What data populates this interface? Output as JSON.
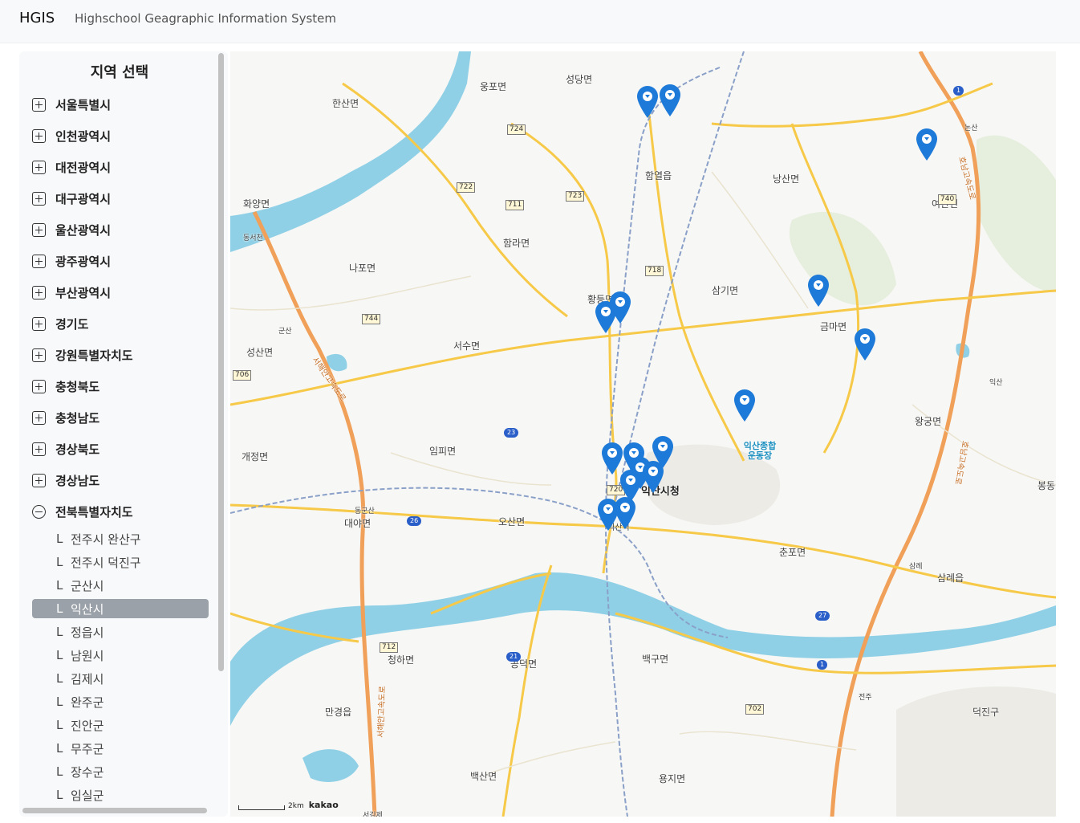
{
  "header": {
    "brand": "HGIS",
    "subtitle": "Highschool Geagraphic Information System"
  },
  "sidebar": {
    "title": "지역 선택",
    "regions": [
      "서울특별시",
      "인천광역시",
      "대전광역시",
      "대구광역시",
      "울산광역시",
      "광주광역시",
      "부산광역시",
      "경기도",
      "강원특별자치도",
      "충청북도",
      "충청남도",
      "경상북도",
      "경상남도",
      "전북특별자치도"
    ],
    "sub_marker": "L",
    "sub_items": [
      "전주시 완산구",
      "전주시 덕진구",
      "군산시",
      "익산시",
      "정읍시",
      "남원시",
      "김제시",
      "완주군",
      "진안군",
      "무주군",
      "장수군",
      "임실군"
    ],
    "selected_sub": "익산시"
  },
  "map": {
    "place_labels": [
      "웅포면",
      "성당면",
      "한산면",
      "함열읍",
      "낭산면",
      "여산면",
      "화양면",
      "동서천",
      "나포면",
      "함라면",
      "삼기면",
      "황등면",
      "금마면",
      "군산",
      "성산면",
      "서수면",
      "왕궁면",
      "임피면",
      "익산",
      "개정면",
      "동군산",
      "대야면",
      "오산면",
      "봉동",
      "춘포면",
      "삼례",
      "삼례읍",
      "청하면",
      "공덕면",
      "백구면",
      "전주",
      "만경읍",
      "덕진구",
      "백산면",
      "용지면",
      "논산",
      "익산역",
      "서김제"
    ],
    "main_label": "익산시청",
    "poi_label": "익산종합 운동장",
    "route_shields": [
      "724",
      "722",
      "711",
      "723",
      "718",
      "744",
      "706",
      "720",
      "712",
      "702",
      "740"
    ],
    "national_shields": [
      "1",
      "23",
      "26",
      "27",
      "21",
      "1"
    ],
    "highway_labels": [
      "서해안고속도로",
      "호남고속도로",
      "호남고속도로",
      "서해안고속도로"
    ],
    "scale_text": "2km",
    "attribution": "kakao",
    "marker_icon": "map-marker-icon"
  },
  "colors": {
    "accent_selected": "#9aa1a8",
    "marker": "#1e7ad8",
    "water": "#8fd0e6",
    "road": "#f7c948",
    "highway": "#f0a058"
  }
}
